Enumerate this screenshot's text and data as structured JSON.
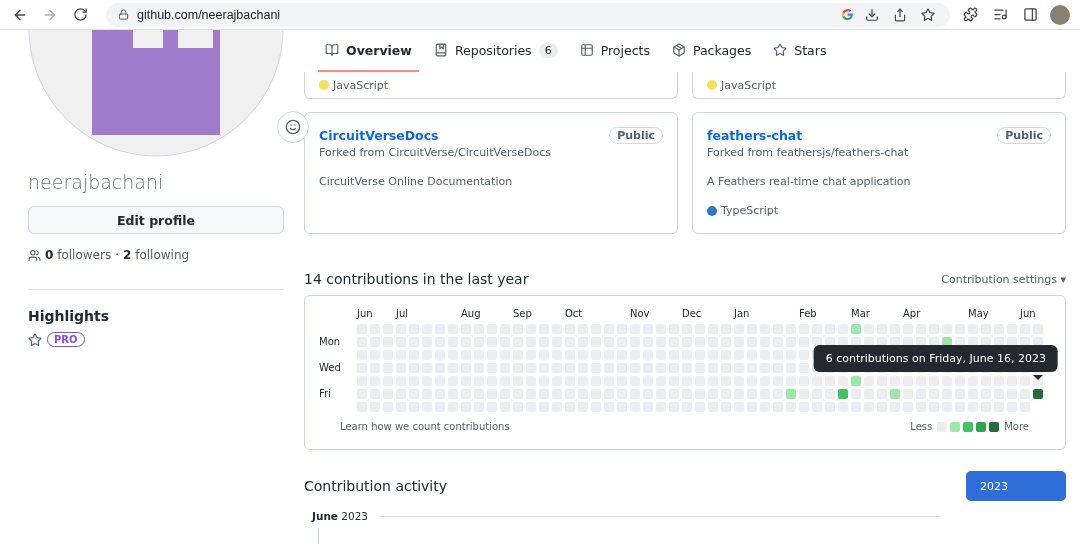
{
  "browser": {
    "url": "github.com/neerajbachani"
  },
  "profile": {
    "username": "neerajbachani",
    "edit_button": "Edit profile",
    "followers": "0",
    "followers_label": "followers",
    "separator": "·",
    "following": "2",
    "following_label": "following"
  },
  "highlights": {
    "title": "Highlights",
    "badge": "PRO"
  },
  "tabs": [
    {
      "label": "Overview",
      "selected": true
    },
    {
      "label": "Repositories",
      "count": "6",
      "selected": false
    },
    {
      "label": "Projects",
      "selected": false
    },
    {
      "label": "Packages",
      "selected": false
    },
    {
      "label": "Stars",
      "selected": false
    }
  ],
  "pinned_partial": [
    {
      "language": "JavaScript",
      "color": "#f1e05a"
    },
    {
      "language": "JavaScript",
      "color": "#f1e05a"
    }
  ],
  "pinned": [
    {
      "name": "CircuitVerseDocs",
      "visibility": "Public",
      "fork_note": "Forked from CircuitVerse/CircuitVerseDocs",
      "description": "CircuitVerse Online Documentation"
    },
    {
      "name": "feathers-chat",
      "visibility": "Public",
      "fork_note": "Forked from feathersjs/feathers-chat",
      "description": "A Feathers real-time chat application",
      "language": "TypeScript",
      "color": "#3178c6"
    }
  ],
  "contributions": {
    "title": "14 contributions in the last year",
    "settings": "Contribution settings",
    "settings_caret": "▾",
    "months": [
      "Jun",
      "Jul",
      "Aug",
      "Sep",
      "Oct",
      "Nov",
      "Dec",
      "Jan",
      "Feb",
      "Mar",
      "Apr",
      "May",
      "Jun"
    ],
    "days": [
      "Mon",
      "Wed",
      "Fri"
    ],
    "active": [
      {
        "color": "#9be9a8"
      },
      {
        "color": "#40c463"
      },
      {
        "color": "#9be9a8"
      },
      {
        "color": "#9be9a8"
      },
      {
        "color": "#9be9a8"
      },
      {
        "color": "#9be9a8"
      },
      {
        "color": "#216e39"
      }
    ],
    "tooltip": "6 contributions on Friday, June 16, 2023",
    "learn_link": "Learn how we count contributions",
    "legend_less": "Less",
    "legend_more": "More"
  },
  "activity": {
    "title": "Contribution activity",
    "year_button": "2023",
    "month": "June",
    "year": "2023"
  }
}
